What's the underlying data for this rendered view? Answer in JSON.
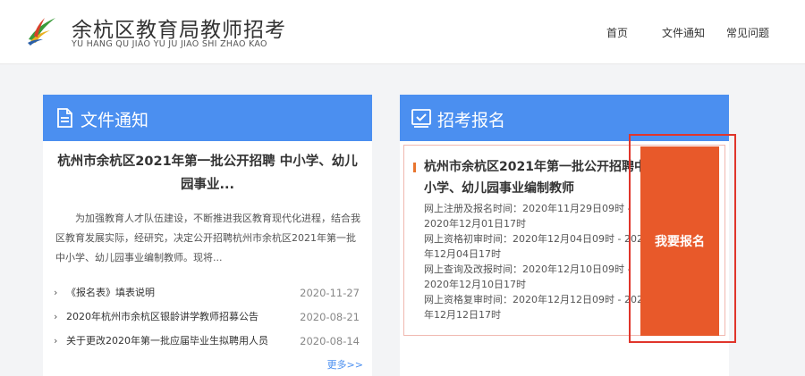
{
  "header": {
    "title_cn": "余杭区教育局教师招考",
    "title_en": "YU HANG QU JIAO YU JU JIAO SHI ZHAO KAO",
    "nav": [
      "首页",
      "文件通知",
      "常见问题"
    ]
  },
  "left_panel": {
    "title": "文件通知",
    "featured_title": "杭州市余杭区2021年第一批公开招聘 中小学、幼儿园事业...",
    "featured_desc": "为加强教育人才队伍建设，不断推进我区教育现代化进程，结合我区教育发展实际，经研究，决定公开招聘杭州市余杭区2021年第一批中小学、幼儿园事业编制教师。现将...",
    "items": [
      {
        "title": "《报名表》填表说明",
        "date": "2020-11-27"
      },
      {
        "title": "2020年杭州市余杭区银龄讲学教师招募公告",
        "date": "2020-08-21"
      },
      {
        "title": "关于更改2020年第一批应届毕业生拟聘用人员",
        "date": "2020-08-14"
      }
    ],
    "more_label": "更多>>"
  },
  "right_panel": {
    "title": "招考报名",
    "exam_title": "杭州市余杭区2021年第一批公开招聘中小学、幼儿园事业编制教师",
    "lines": [
      "网上注册及报名时间：2020年11月29日09时 - 2020年12月01日17时",
      "网上资格初审时间：2020年12月04日09时 - 2020年12月04日17时",
      "网上查询及改报时间：2020年12月10日09时 - 2020年12月10日17时",
      "网上资格复审时间：2020年12月12日09时 - 2020年12月12日17时"
    ],
    "register_label": "我要报名"
  },
  "colors": {
    "accent_blue": "#4b8ff0",
    "register_orange": "#e8592a",
    "highlight_red": "#e0352b"
  }
}
